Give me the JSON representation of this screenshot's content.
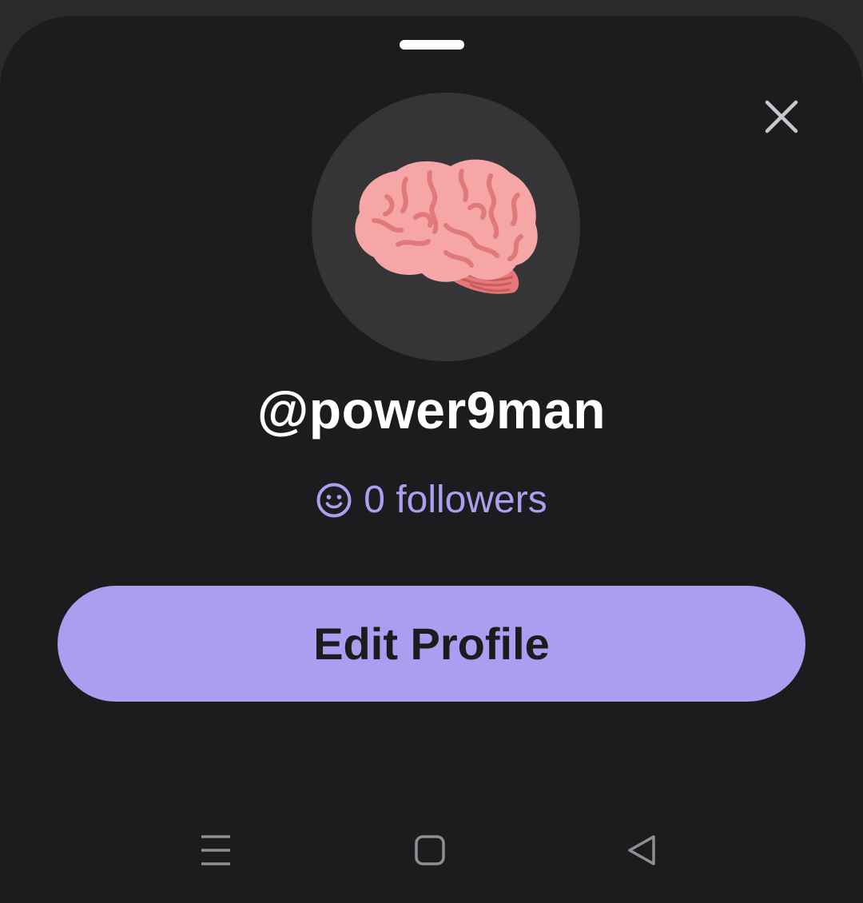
{
  "colors": {
    "background": "#2a2a2c",
    "sheet": "#1c1c1e",
    "avatar_bg": "#353537",
    "accent": "#ab9ef0",
    "followers_text": "#ad9ff0",
    "text_primary": "#ffffff",
    "nav_icon": "#8e8e93"
  },
  "sheet": {
    "grabber_icon": "drag-handle",
    "close_icon": "close-x"
  },
  "profile": {
    "avatar_icon": "brain-emoji",
    "username": "@power9man",
    "followers_icon": "smiley-face",
    "followers_text": "0 followers",
    "edit_button_label": "Edit Profile"
  },
  "navigation_bar": {
    "recents_icon": "recents-menu",
    "home_icon": "home-square",
    "back_icon": "back-triangle"
  }
}
